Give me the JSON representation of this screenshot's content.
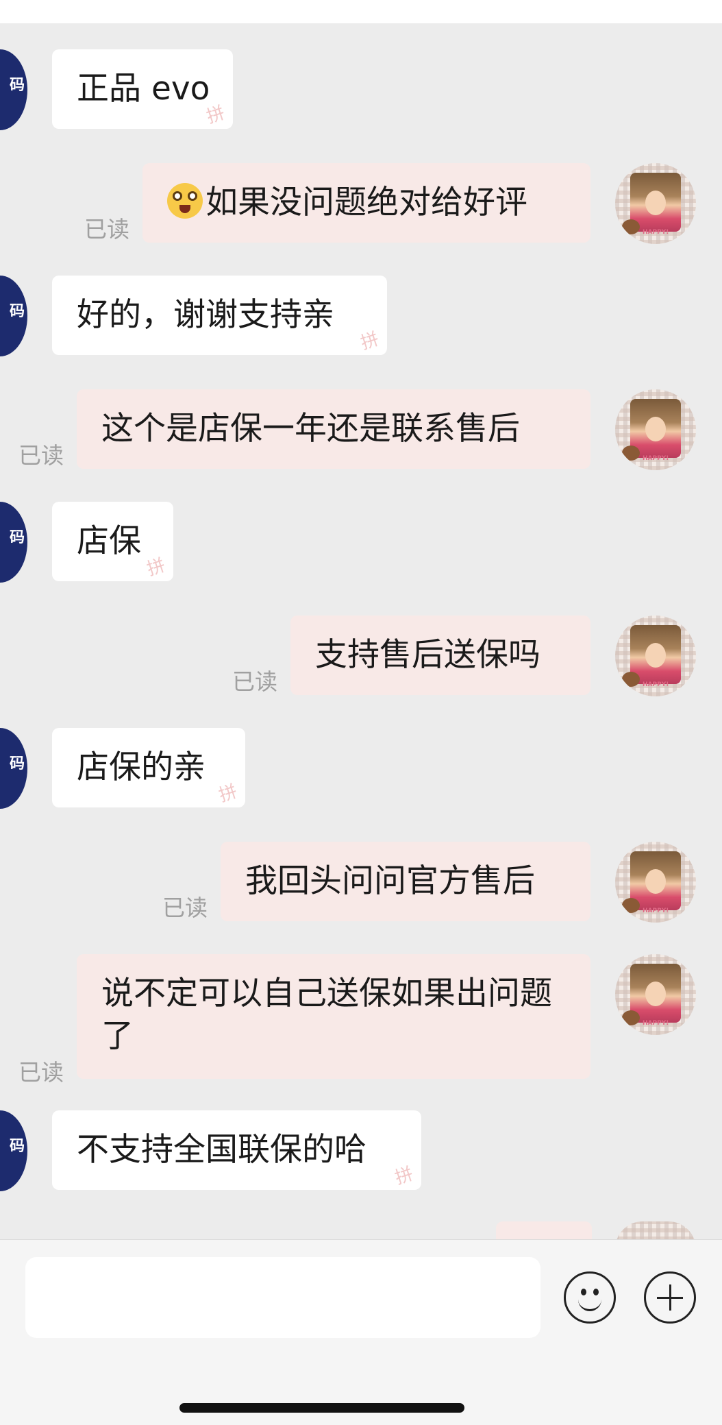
{
  "seller_avatar_text": "码",
  "watermark": "拼",
  "read_label": "已读",
  "messages": [
    {
      "side": "in",
      "text": "正品 evo"
    },
    {
      "side": "out",
      "text": "如果没问题绝对给好评",
      "emoji": "star-eyes-emoji"
    },
    {
      "side": "in",
      "text": "好的，谢谢支持亲"
    },
    {
      "side": "out",
      "text": "这个是店保一年还是联系售后"
    },
    {
      "side": "in",
      "text": "店保"
    },
    {
      "side": "out",
      "text": "支持售后送保吗"
    },
    {
      "side": "in",
      "text": "店保的亲"
    },
    {
      "side": "out",
      "text": "我回头问问官方售后"
    },
    {
      "side": "out",
      "text": "说不定可以自己送保如果出问题了"
    },
    {
      "side": "in",
      "text": "不支持全国联保的哈"
    }
  ],
  "buyer_avatar_caption": "HAPPY!",
  "input": {
    "placeholder": "",
    "value": ""
  },
  "icons": {
    "emoji": "smiley-icon",
    "plus": "plus-circle-icon"
  }
}
